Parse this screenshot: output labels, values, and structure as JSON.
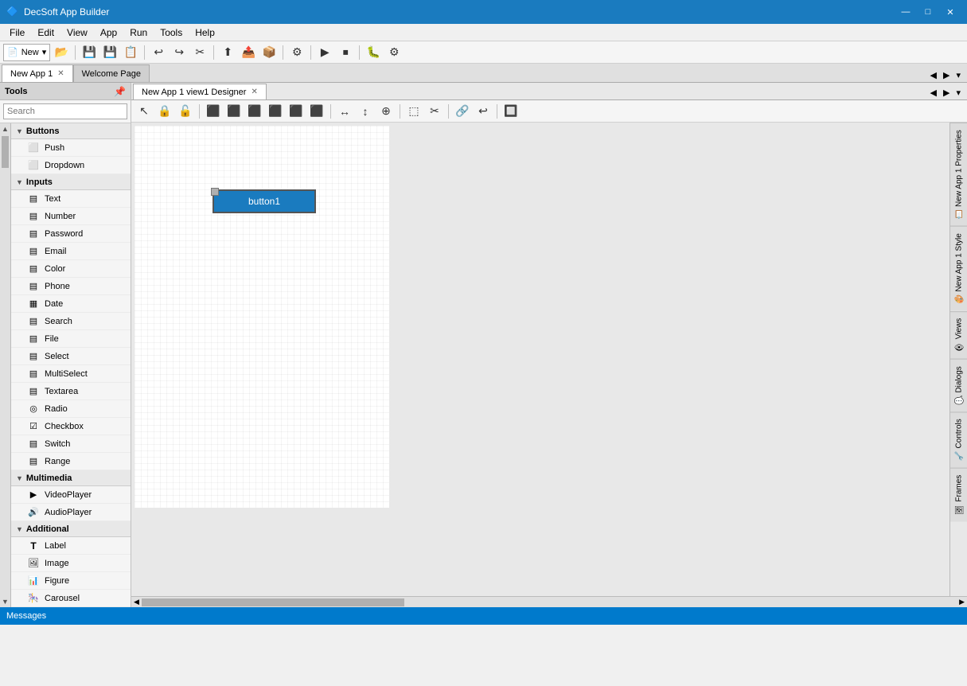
{
  "app": {
    "title": "DecSoft App Builder",
    "icon": "🔷"
  },
  "title_bar": {
    "title": "DecSoft App Builder",
    "minimize": "—",
    "maximize": "□",
    "close": "✕"
  },
  "menu": {
    "items": [
      "File",
      "Edit",
      "View",
      "App",
      "Run",
      "Tools",
      "Help"
    ]
  },
  "toolbar1": {
    "new_dropdown": "New",
    "open": "📂",
    "save": "💾",
    "save_all": "💾",
    "close": "✕"
  },
  "document_tabs": {
    "tabs": [
      {
        "label": "New App 1",
        "active": true
      },
      {
        "label": "Welcome Page",
        "active": false
      }
    ]
  },
  "tools_panel": {
    "title": "Tools",
    "search_placeholder": "Search",
    "categories": [
      {
        "name": "Buttons",
        "items": [
          {
            "label": "Push",
            "icon": "⬜"
          },
          {
            "label": "Dropdown",
            "icon": "⬜"
          }
        ]
      },
      {
        "name": "Inputs",
        "items": [
          {
            "label": "Text",
            "icon": "▤"
          },
          {
            "label": "Number",
            "icon": "▤"
          },
          {
            "label": "Password",
            "icon": "▤"
          },
          {
            "label": "Email",
            "icon": "▤"
          },
          {
            "label": "Color",
            "icon": "▤"
          },
          {
            "label": "Phone",
            "icon": "▤"
          },
          {
            "label": "Date",
            "icon": "▦"
          },
          {
            "label": "Search",
            "icon": "▤"
          },
          {
            "label": "File",
            "icon": "▤"
          },
          {
            "label": "Select",
            "icon": "▤"
          },
          {
            "label": "MultiSelect",
            "icon": "▤"
          },
          {
            "label": "Textarea",
            "icon": "▤"
          },
          {
            "label": "Radio",
            "icon": "◎"
          },
          {
            "label": "Checkbox",
            "icon": "☑"
          },
          {
            "label": "Switch",
            "icon": "▤"
          },
          {
            "label": "Range",
            "icon": "▤"
          }
        ]
      },
      {
        "name": "Multimedia",
        "items": [
          {
            "label": "VideoPlayer",
            "icon": "▶"
          },
          {
            "label": "AudioPlayer",
            "icon": "🔊"
          }
        ]
      },
      {
        "name": "Additional",
        "items": [
          {
            "label": "Label",
            "icon": "T"
          },
          {
            "label": "Image",
            "icon": "🖼"
          },
          {
            "label": "Figure",
            "icon": "📊"
          },
          {
            "label": "Carousel",
            "icon": "🎠"
          }
        ]
      }
    ]
  },
  "designer": {
    "tab_label": "New App 1 view1 Designer",
    "close": "✕"
  },
  "canvas": {
    "button_label": "button1"
  },
  "right_panels": [
    {
      "label": "New App 1 Properties",
      "icon": "📋"
    },
    {
      "label": "New App 1 Style",
      "icon": "🎨"
    },
    {
      "label": "Views",
      "icon": "👁"
    },
    {
      "label": "Dialogs",
      "icon": "💬"
    },
    {
      "label": "Controls",
      "icon": "🔧"
    },
    {
      "label": "Frames",
      "icon": "🖼"
    }
  ],
  "status_bar": {
    "label": "Messages"
  },
  "designer_toolbar": {
    "buttons": [
      "↖",
      "🔒",
      "🔓",
      "⬜",
      "⬜",
      "⬜",
      "⬜",
      "⬜",
      "⬜",
      "⬜",
      "⬜",
      "⬜",
      "⬜",
      "⬜",
      "⊕",
      "⬚",
      "✂",
      "🔗",
      "↩",
      "🔲"
    ]
  }
}
